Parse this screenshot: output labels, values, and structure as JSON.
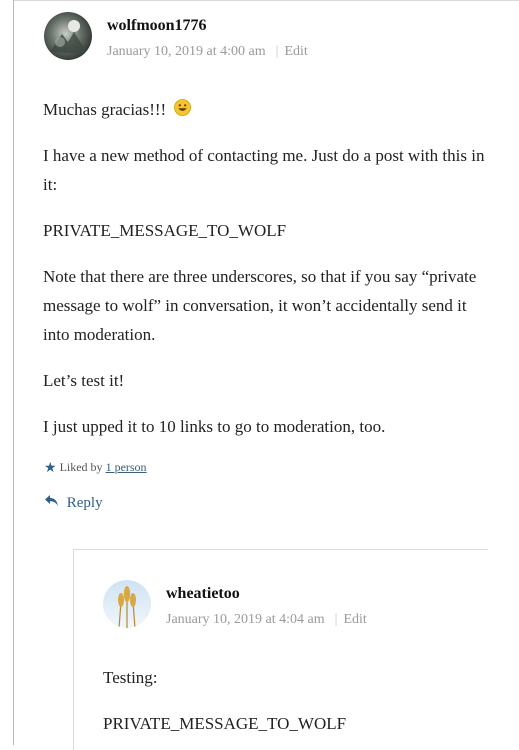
{
  "comment1": {
    "author": "wolfmoon1776",
    "date": "January 10, 2019 at 4:00 am",
    "edit_label": "Edit",
    "body": [
      "Muchas gracias!!!",
      "I have a new method of contacting me. Just do a post with this in it:",
      "PRIVATE_MESSAGE_TO_WOLF",
      "Note that there are three underscores, so that if you say “private message to wolf” in conversation, it won’t accidentally send it into moderation.",
      "Let’s test it!",
      "I just upped it to 10 links to go to moderation, too."
    ],
    "liked_by": "Liked by",
    "liked_count": "1 person",
    "reply_label": "Reply"
  },
  "comment2": {
    "author": "wheatietoo",
    "date": "January 10, 2019 at 4:04 am",
    "edit_label": "Edit",
    "body": [
      "Testing:",
      "PRIVATE_MESSAGE_TO_WOLF"
    ]
  }
}
